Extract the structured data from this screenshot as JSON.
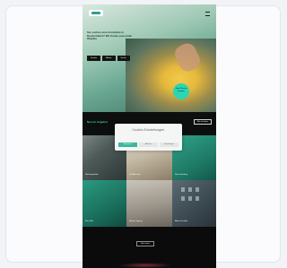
{
  "hero": {
    "headline": "Sie suchen eine Immobilie in Deutschland? Wir finden passende Objekte",
    "buttons": [
      "Kaufen",
      "Mieten",
      "Suche"
    ],
    "sticker": "Jetzt Termin buchen"
  },
  "section": {
    "title": "Neu im Angebot",
    "button": "Alle anzeigen"
  },
  "tiles": [
    {
      "label": "Wohnung Berlin"
    },
    {
      "label": "Loft München"
    },
    {
      "label": "Haus Hamburg"
    },
    {
      "label": "Büro Köln"
    },
    {
      "label": "Neubau Leipzig"
    },
    {
      "label": "Altbau Dresden"
    }
  ],
  "lower": {
    "button": "Mehr laden"
  },
  "cookie_dialog": {
    "title": "Cookie-Einstellungen",
    "text": "Wir verwenden Cookies, um Ihnen das beste Erlebnis zu bieten.",
    "accept": "Akzeptieren",
    "decline": "Ablehnen",
    "settings": "Einstellungen"
  },
  "colors": {
    "accent": "#3bb89c",
    "background": "#101212",
    "dialog": "#f4f6f5"
  }
}
